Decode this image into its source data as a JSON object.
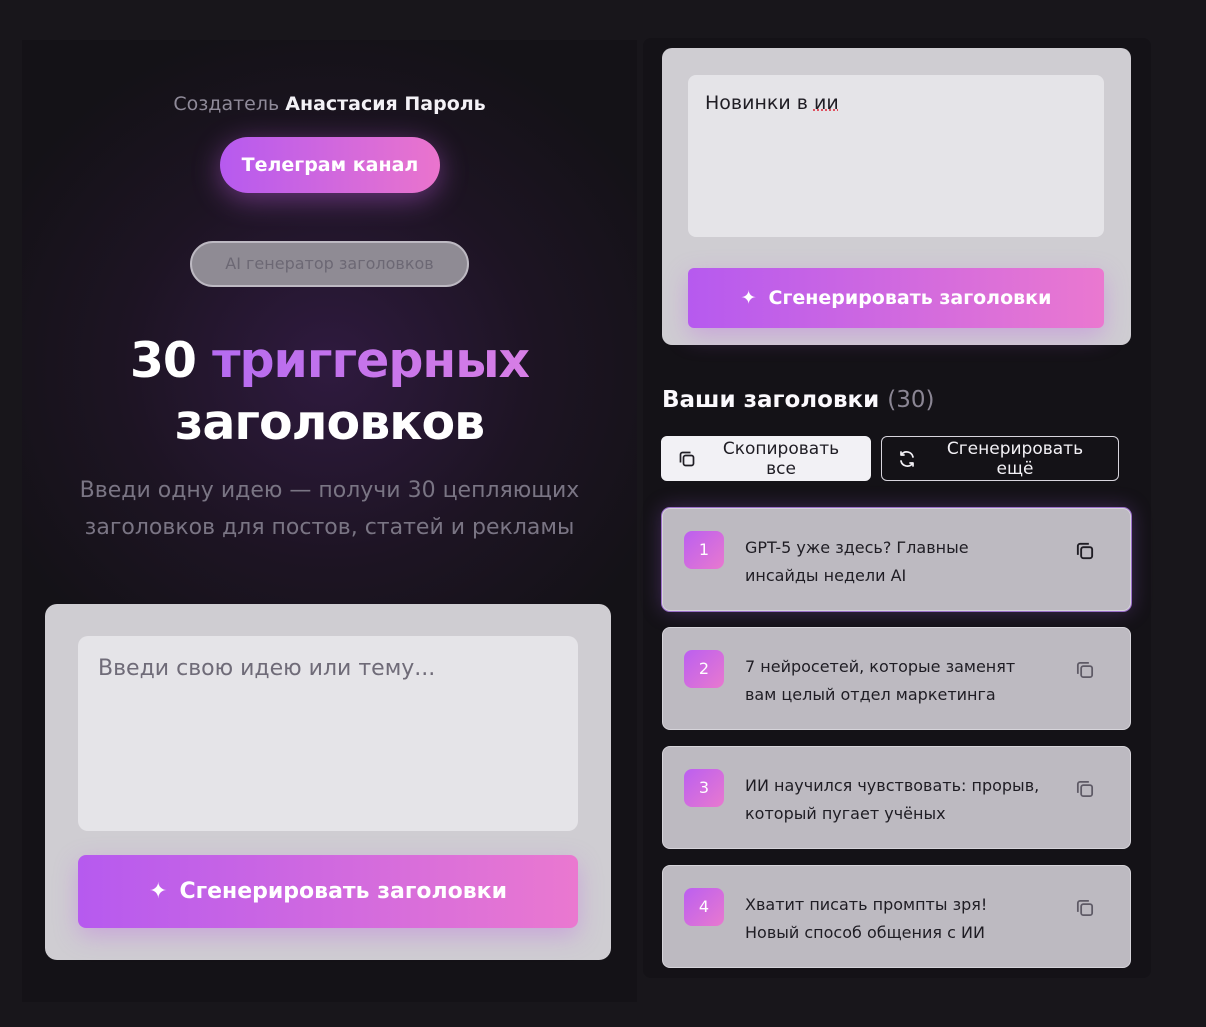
{
  "left": {
    "creator_prefix": "Создатель",
    "creator_name": "Анастасия Пароль",
    "telegram_label": "Телеграм канал",
    "badge_label": "AI генератор заголовков",
    "hero_number": "30",
    "hero_accent": "триггерных",
    "hero_rest": "заголовков",
    "subtitle": "Введи одну идею — получи 30 цепляющих заголовков для постов, статей и рекламы",
    "input_placeholder": "Введи свою идею или тему...",
    "generate_label": "Сгенерировать заголовки"
  },
  "right": {
    "input_value_prefix": "Новинки в ",
    "input_value_last": "ии",
    "generate_label": "Сгенерировать заголовки",
    "results_title": "Ваши заголовки",
    "results_count": "(30)",
    "copy_all_label": "Скопировать все",
    "regenerate_label": "Сгенерировать ещё",
    "items": [
      {
        "num": "1",
        "text": "GPT-5 уже здесь? Главные инсайды недели AI"
      },
      {
        "num": "2",
        "text": "7 нейросетей, которые заменят вам целый отдел маркетинга"
      },
      {
        "num": "3",
        "text": "ИИ научился чувствовать: прорыв, который пугает учёных"
      },
      {
        "num": "4",
        "text": "Хватит писать промпты зря! Новый способ общения с ИИ"
      }
    ]
  },
  "icons": {
    "sparkle": "sparkle-icon",
    "copy": "copy-icon",
    "refresh": "refresh-icon"
  },
  "colors": {
    "accent_start": "#b65aef",
    "accent_end": "#ea74cd",
    "background": "#18161b"
  }
}
